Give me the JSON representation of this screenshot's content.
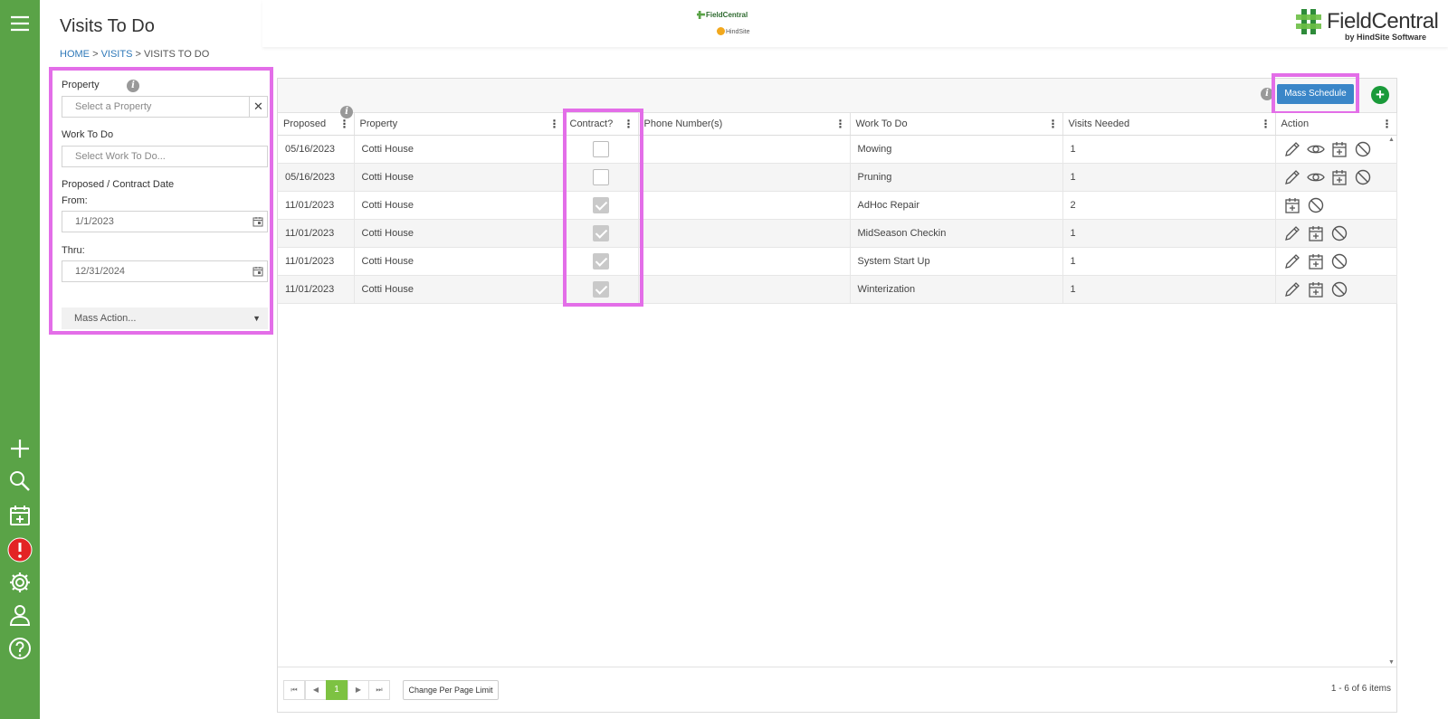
{
  "page": {
    "title": "Visits To Do"
  },
  "breadcrumb": {
    "home": "HOME",
    "sep": ">",
    "visits": "VISITS",
    "current": "VISITS TO DO"
  },
  "logos": {
    "center_top": "FieldCentral",
    "center_bottom": "HindSite",
    "brand_name": "FieldCentral",
    "brand_by": "by HindSite Software"
  },
  "filters": {
    "property_label": "Property",
    "property_placeholder": "Select a Property",
    "work_label": "Work To Do",
    "work_placeholder": "Select Work To Do...",
    "date_label": "Proposed / Contract Date",
    "from_label": "From:",
    "from_value": "1/1/2023",
    "thru_label": "Thru:",
    "thru_value": "12/31/2024",
    "mass_action": "Mass Action...",
    "clear_glyph": "✕",
    "caret_glyph": "▼"
  },
  "toolbar": {
    "mass_schedule": "Mass Schedule",
    "add": "+"
  },
  "grid": {
    "columns": [
      "Proposed",
      "Property",
      "Contract?",
      "Phone Number(s)",
      "Work To Do",
      "Visits Needed",
      "Action"
    ],
    "rows": [
      {
        "proposed": "05/16/2023",
        "property": "Cotti House",
        "contract": false,
        "phone": "",
        "work": "Mowing",
        "visits": "1",
        "actions": [
          "pencil-icon",
          "eye-icon",
          "calendar-add-icon",
          "cancel-icon"
        ]
      },
      {
        "proposed": "05/16/2023",
        "property": "Cotti House",
        "contract": false,
        "phone": "",
        "work": "Pruning",
        "visits": "1",
        "actions": [
          "pencil-icon",
          "eye-icon",
          "calendar-add-icon",
          "cancel-icon"
        ]
      },
      {
        "proposed": "11/01/2023",
        "property": "Cotti House",
        "contract": true,
        "phone": "",
        "work": "AdHoc Repair",
        "visits": "2",
        "actions": [
          "calendar-add-icon",
          "cancel-icon"
        ]
      },
      {
        "proposed": "11/01/2023",
        "property": "Cotti House",
        "contract": true,
        "phone": "",
        "work": "MidSeason Checkin",
        "visits": "1",
        "actions": [
          "pencil-icon",
          "calendar-add-icon",
          "cancel-icon"
        ]
      },
      {
        "proposed": "11/01/2023",
        "property": "Cotti House",
        "contract": true,
        "phone": "",
        "work": "System Start Up",
        "visits": "1",
        "actions": [
          "pencil-icon",
          "calendar-add-icon",
          "cancel-icon"
        ]
      },
      {
        "proposed": "11/01/2023",
        "property": "Cotti House",
        "contract": true,
        "phone": "",
        "work": "Winterization",
        "visits": "1",
        "actions": [
          "pencil-icon",
          "calendar-add-icon",
          "cancel-icon"
        ]
      }
    ]
  },
  "pager": {
    "first": "⏮",
    "prev": "◀",
    "current_page": "1",
    "next": "▶",
    "last": "⏭",
    "per_page_label": "Change Per Page Limit",
    "count": "1 - 6 of 6 items"
  },
  "nav_icons": [
    "menu-icon",
    "plus-icon",
    "search-icon",
    "calendar-add-icon",
    "alert-icon",
    "gear-icon",
    "user-icon",
    "help-icon"
  ],
  "colors": {
    "nav_green": "#5aa347",
    "highlight": "#e36ee8",
    "primary_blue": "#3a86c8",
    "add_green": "#1a9a3a",
    "alert_red": "#e32424"
  }
}
